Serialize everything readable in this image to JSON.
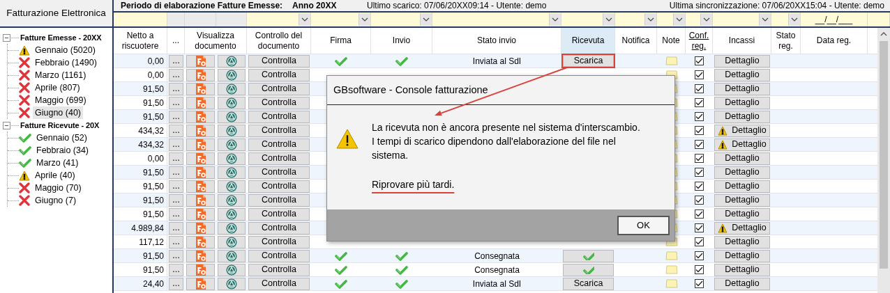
{
  "sidebar": {
    "title": "Fatturazione Elettronica",
    "groups": [
      {
        "label": "Fatture Emesse - 20XX",
        "expanded": true,
        "children": [
          {
            "label": "Gennaio (5020)",
            "kind": "warning",
            "selected": false
          },
          {
            "label": "Febbraio (1490)",
            "kind": "error",
            "selected": false
          },
          {
            "label": "Marzo (1161)",
            "kind": "error",
            "selected": false
          },
          {
            "label": "Aprile (807)",
            "kind": "error",
            "selected": false
          },
          {
            "label": "Maggio (699)",
            "kind": "error",
            "selected": false
          },
          {
            "label": "Giugno (40)",
            "kind": "error",
            "selected": true
          }
        ]
      },
      {
        "label": "Fatture Ricevute - 20X",
        "expanded": true,
        "children": [
          {
            "label": "Gennaio (52)",
            "kind": "ok",
            "selected": false
          },
          {
            "label": "Febbraio (34)",
            "kind": "ok",
            "selected": false
          },
          {
            "label": "Marzo (41)",
            "kind": "ok",
            "selected": false
          },
          {
            "label": "Aprile (40)",
            "kind": "warning",
            "selected": false
          },
          {
            "label": "Maggio (70)",
            "kind": "error",
            "selected": false
          },
          {
            "label": "Giugno (7)",
            "kind": "error",
            "selected": false
          }
        ]
      }
    ]
  },
  "info_bar": {
    "period_label": "Periodo di elaborazione Fatture Emesse:",
    "period_value": "Anno 20XX",
    "last_download": "Ultimo scarico: 07/06/20XX09:14 - Utente: demo",
    "last_sync": "Ultima sincronizzazione: 07/06/20XX15:04 - Utente: demo"
  },
  "table": {
    "filters": [
      {
        "kind": "text"
      },
      {
        "kind": "none"
      },
      {
        "kind": "none"
      },
      {
        "kind": "none"
      },
      {
        "kind": "dropdown"
      },
      {
        "kind": "dropdown"
      },
      {
        "kind": "dropdown"
      },
      {
        "kind": "dropdown"
      },
      {
        "kind": "dropdown"
      },
      {
        "kind": "dropdown"
      },
      {
        "kind": "dropdown"
      },
      {
        "kind": "dropdown"
      },
      {
        "kind": "dropdown"
      },
      {
        "kind": "dropdown"
      },
      {
        "kind": "date",
        "value": "__/__/___"
      }
    ],
    "columns": [
      {
        "label": "Netto a riscuotere",
        "selected": false,
        "underlined": false
      },
      {
        "label": "...",
        "selected": false,
        "underlined": false
      },
      {
        "label": "Visualizza documento",
        "selected": false,
        "underlined": false
      },
      {
        "label": "Controllo del documento",
        "selected": false,
        "underlined": false
      },
      {
        "label": "Firma",
        "selected": false,
        "underlined": false
      },
      {
        "label": "Invio",
        "selected": false,
        "underlined": false
      },
      {
        "label": "Stato invio",
        "selected": false,
        "underlined": false
      },
      {
        "label": "Ricevuta",
        "selected": true,
        "underlined": false
      },
      {
        "label": "Notifica",
        "selected": false,
        "underlined": false
      },
      {
        "label": "Note",
        "selected": false,
        "underlined": false
      },
      {
        "label": "Conf. reg.",
        "selected": false,
        "underlined": true
      },
      {
        "label": "Incassi",
        "selected": false,
        "underlined": false
      },
      {
        "label": "Stato reg.",
        "selected": false,
        "underlined": false
      },
      {
        "label": "Data reg.",
        "selected": false,
        "underlined": false
      }
    ],
    "rows": [
      {
        "netto": "0,00",
        "more": "...",
        "check": "Controlla",
        "firma": true,
        "invio": true,
        "stato_invio": "Inviata al SdI",
        "ricevuta": {
          "kind": "button",
          "label": "Scarica",
          "marked": true
        },
        "conf_reg": true,
        "incassi": "Dettaglio",
        "incassi_warning": false
      },
      {
        "netto": "0,00",
        "more": "...",
        "check": "Controlla",
        "conf_reg": true,
        "incassi": "Dettaglio",
        "incassi_warning": false
      },
      {
        "netto": "91,50",
        "more": "...",
        "check": "Controlla",
        "conf_reg": true,
        "incassi": "Dettaglio",
        "incassi_warning": false
      },
      {
        "netto": "91,50",
        "more": "...",
        "check": "Controlla",
        "conf_reg": true,
        "incassi": "Dettaglio",
        "incassi_warning": false
      },
      {
        "netto": "91,50",
        "more": "...",
        "check": "Controlla",
        "conf_reg": true,
        "incassi": "Dettaglio",
        "incassi_warning": false
      },
      {
        "netto": "434,32",
        "more": "...",
        "check": "Controlla",
        "conf_reg": true,
        "incassi": "Dettaglio",
        "incassi_warning": true
      },
      {
        "netto": "434,32",
        "more": "...",
        "check": "Controlla",
        "conf_reg": true,
        "incassi": "Dettaglio",
        "incassi_warning": true
      },
      {
        "netto": "0,00",
        "more": "...",
        "check": "Controlla",
        "conf_reg": true,
        "incassi": "Dettaglio",
        "incassi_warning": false
      },
      {
        "netto": "91,50",
        "more": "...",
        "check": "Controlla",
        "conf_reg": true,
        "incassi": "Dettaglio",
        "incassi_warning": false
      },
      {
        "netto": "91,50",
        "more": "...",
        "check": "Controlla",
        "conf_reg": true,
        "incassi": "Dettaglio",
        "incassi_warning": false
      },
      {
        "netto": "91,50",
        "more": "...",
        "check": "Controlla",
        "conf_reg": true,
        "incassi": "Dettaglio",
        "incassi_warning": false
      },
      {
        "netto": "91,50",
        "more": "...",
        "check": "Controlla",
        "conf_reg": true,
        "incassi": "Dettaglio",
        "incassi_warning": false
      },
      {
        "netto": "4.989,84",
        "more": "...",
        "check": "Controlla",
        "conf_reg": true,
        "incassi": "Dettaglio",
        "incassi_warning": true
      },
      {
        "netto": "117,12",
        "more": "...",
        "check": "Controlla",
        "conf_reg": true,
        "incassi": "Dettaglio",
        "incassi_warning": false
      },
      {
        "netto": "91,50",
        "more": "...",
        "check": "Controlla",
        "firma": true,
        "invio": true,
        "stato_invio": "Consegnata",
        "ricevuta": {
          "kind": "check",
          "marked": false
        },
        "conf_reg": true,
        "incassi": "Dettaglio",
        "incassi_warning": false
      },
      {
        "netto": "91,50",
        "more": "...",
        "check": "Controlla",
        "firma": true,
        "invio": true,
        "stato_invio": "Consegnata",
        "ricevuta": {
          "kind": "check",
          "marked": false
        },
        "conf_reg": true,
        "incassi": "Dettaglio",
        "incassi_warning": false
      },
      {
        "netto": "24,40",
        "more": "...",
        "check": "Controlla",
        "firma": true,
        "invio": true,
        "stato_invio": "Inviata al SdI",
        "ricevuta": {
          "kind": "button",
          "label": "Scarica",
          "marked": false
        },
        "conf_reg": true,
        "incassi": "Dettaglio",
        "incassi_warning": false
      }
    ]
  },
  "dialog": {
    "title": "GBsoftware - Console fatturazione",
    "message": [
      "La ricevuta non è ancora presente nel sistema d'interscambio.",
      "I tempi di scarico dipendono dall'elaborazione del file nel sistema."
    ],
    "emphasis": "Riprovare più tardi.",
    "emphasis_underlined": true,
    "button": "OK"
  }
}
